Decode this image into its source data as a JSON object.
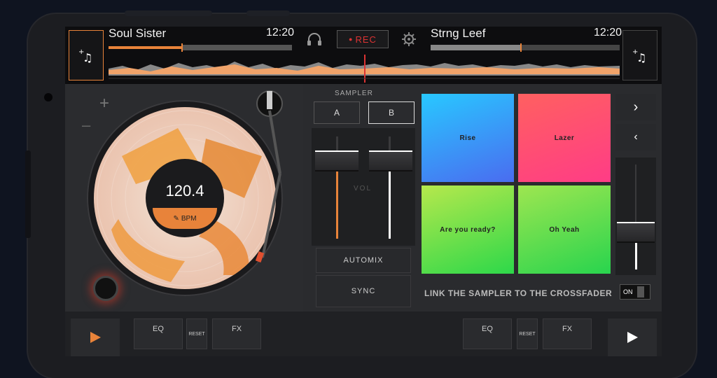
{
  "deck_left": {
    "track": "Soul Sister",
    "time": "12:20",
    "bpm": "120.4",
    "bpm_label": "BPM"
  },
  "deck_right": {
    "track": "Strng Leef",
    "time": "12:20"
  },
  "rec_label": "REC",
  "sampler": {
    "label": "SAMPLER",
    "bank_a": "A",
    "bank_b": "B",
    "selected": "B"
  },
  "mixer": {
    "vol_label": "VOL",
    "left_fader": 0.35,
    "right_fader": 0.35
  },
  "automix": "AUTOMIX",
  "sync": "SYNC",
  "pads": [
    {
      "label": "Rise",
      "color_top": "#28c8ff",
      "color_bottom": "#4a6cf0"
    },
    {
      "label": "Lazer",
      "color_top": "#ff5c6c",
      "color_bottom": "#ff3c86"
    },
    {
      "label": "Are you ready?",
      "color_top": "#9ee84c",
      "color_bottom": "#2dd84a"
    },
    {
      "label": "Oh Yeah",
      "color_top": "#8fe650",
      "color_bottom": "#28d44e"
    }
  ],
  "link_text": "LINK THE SAMPLER TO THE CROSSFADER",
  "link_toggle": "ON",
  "bottom": {
    "eq_left": "EQ",
    "reset_left": "RESET",
    "fx_left": "FX",
    "eq_right": "EQ",
    "reset_right": "RESET",
    "fx_right": "FX"
  },
  "colors": {
    "accent": "#e8833a",
    "rec": "#dd3333"
  }
}
